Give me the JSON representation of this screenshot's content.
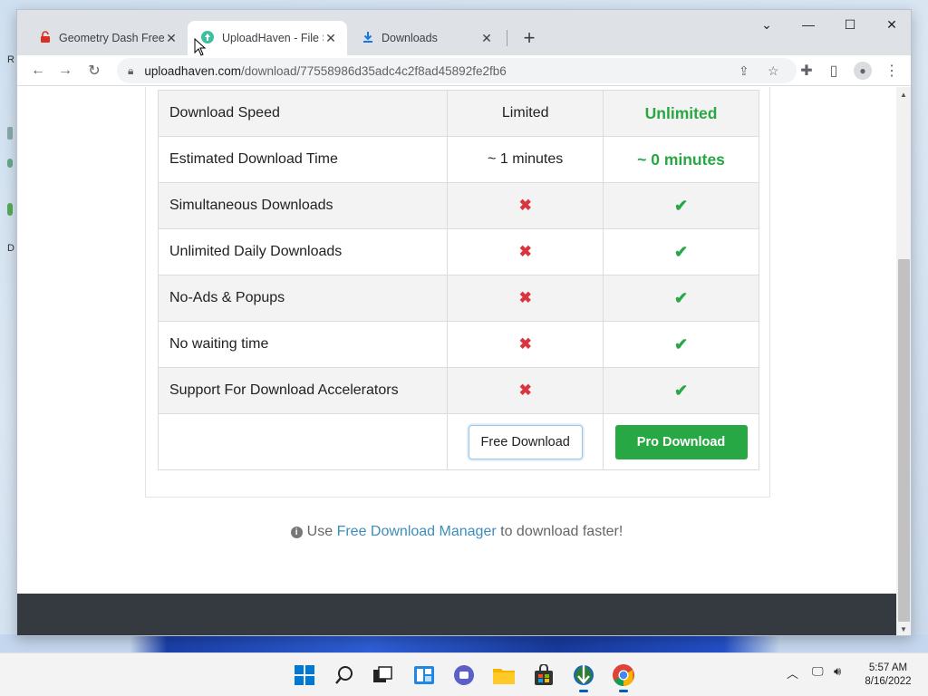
{
  "desktop": {
    "bits": [
      "R",
      "",
      "",
      "D"
    ]
  },
  "browser": {
    "tabs": [
      {
        "title": "Geometry Dash Free",
        "icon": "unlock-icon"
      },
      {
        "title": "UploadHaven - File S",
        "icon": "uploadhaven-logo-icon"
      },
      {
        "title": "Downloads",
        "icon": "download-icon"
      }
    ],
    "url_host": "uploadhaven.com",
    "url_path": "/download/77558986d35adc4c2f8ad45892fe2fb6"
  },
  "comparison": {
    "rows": [
      {
        "feature": "Download Speed",
        "limited": "Limited",
        "pro": "Unlimited"
      },
      {
        "feature": "Estimated Download Time",
        "limited": "~ 1 minutes",
        "pro": "~ 0 minutes"
      },
      {
        "feature": "Simultaneous Downloads",
        "limited": "✖",
        "pro": "✔"
      },
      {
        "feature": "Unlimited Daily Downloads",
        "limited": "✖",
        "pro": "✔"
      },
      {
        "feature": "No-Ads & Popups",
        "limited": "✖",
        "pro": "✔"
      },
      {
        "feature": "No waiting time",
        "limited": "✖",
        "pro": "✔"
      },
      {
        "feature": "Support For Download Accelerators",
        "limited": "✖",
        "pro": "✔"
      }
    ],
    "free_button": "Free Download",
    "pro_button": "Pro Download"
  },
  "hint": {
    "prefix": "Use",
    "link": "Free Download Manager",
    "suffix": "to download faster!"
  },
  "taskbar": {
    "time": "5:57 AM",
    "date": "8/16/2022"
  },
  "colors": {
    "pro_green": "#28a745",
    "cross_red": "#d9353f",
    "link_blue": "#3c8dbc",
    "footer_dark": "#343a40"
  }
}
